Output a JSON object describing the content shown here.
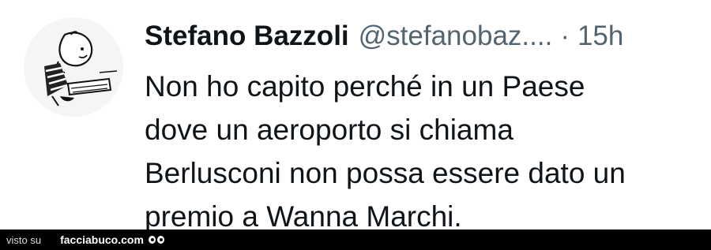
{
  "tweet": {
    "author_name": "Stefano Bazzoli",
    "handle": "@stefanobaz....",
    "separator": "·",
    "time": "15h",
    "lines": [
      "Non ho capito perché in un Paese",
      "dove un aeroporto si chiama",
      "Berlusconi non possa essere dato un",
      "premio a Wanna Marchi."
    ]
  },
  "footer": {
    "visto_label": "visto su",
    "site": "facciabuco.com"
  },
  "icons": {
    "avatar": "cartoon-character-avatar",
    "footer_logo": "eyes-icon"
  }
}
